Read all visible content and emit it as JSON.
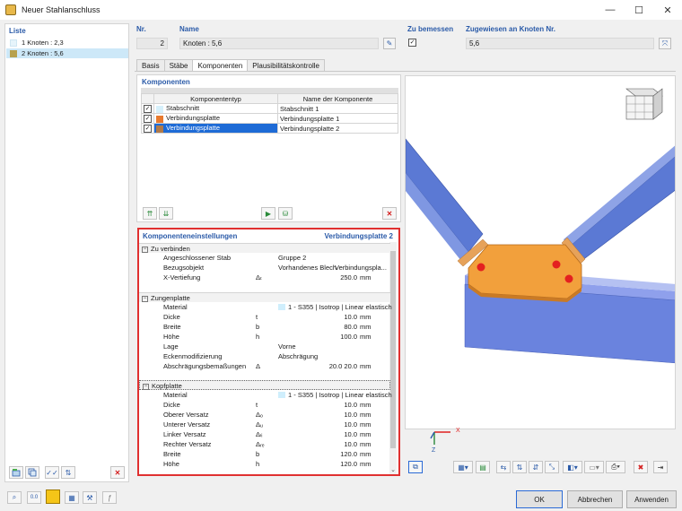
{
  "window": {
    "title": "Neuer Stahlanschluss"
  },
  "list": {
    "title": "Liste",
    "items": [
      {
        "label": "1  Knoten : 2,3",
        "color": "#e6f4fb"
      },
      {
        "label": "2  Knoten : 5,6",
        "color": "#b7a14d"
      }
    ]
  },
  "header": {
    "nr_label": "Nr.",
    "nr_value": "2",
    "name_label": "Name",
    "name_value": "Knoten : 5,6",
    "design_label": "Zu bemessen",
    "design_checked": "✓",
    "nodes_label": "Zugewiesen an Knoten Nr.",
    "nodes_value": "5,6"
  },
  "tabs": [
    "Basis",
    "Stäbe",
    "Komponenten",
    "Plausibilitätskontrolle"
  ],
  "components": {
    "title": "Komponenten",
    "col_type": "Komponententyp",
    "col_name": "Name der Komponente",
    "rows": [
      {
        "type": "Stabschnitt",
        "name": "Stabschnitt 1",
        "color": "#d6f0fb"
      },
      {
        "type": "Verbindungsplatte",
        "name": "Verbindungsplatte 1",
        "color": "#e87a2e"
      },
      {
        "type": "Verbindungsplatte",
        "name": "Verbindungsplatte 2",
        "color": "#e87a2e"
      }
    ]
  },
  "settings": {
    "title": "Komponenteneinstellungen",
    "subtitle": "Verbindungsplatte 2",
    "g1": "Zu verbinden",
    "g1_rows": [
      {
        "name": "Angeschlossener Stab",
        "sym": "",
        "val": "Gruppe 2",
        "val2": "",
        "unit": ""
      },
      {
        "name": "Bezugsobjekt",
        "sym": "",
        "val": "Vorhandenes Blech",
        "val2": "Verbindungspla...",
        "unit": ""
      },
      {
        "name": "X-Vertiefung",
        "sym": "Δₜ",
        "val": "250.0",
        "val2": "",
        "unit": "mm"
      }
    ],
    "g2": "Zungenplatte",
    "g2_rows": [
      {
        "name": "Material",
        "sym": "",
        "val": "1 - S355 | Isotrop | Linear elastisch",
        "unit": ""
      },
      {
        "name": "Dicke",
        "sym": "t",
        "val": "10.0",
        "unit": "mm"
      },
      {
        "name": "Breite",
        "sym": "b",
        "val": "80.0",
        "unit": "mm"
      },
      {
        "name": "Höhe",
        "sym": "h",
        "val": "100.0",
        "unit": "mm"
      },
      {
        "name": "Lage",
        "sym": "",
        "val": "Vorne",
        "unit": ""
      },
      {
        "name": "Eckenmodifizierung",
        "sym": "",
        "val": "Abschrägung",
        "unit": ""
      },
      {
        "name": "Abschrägungsbemaßungen",
        "sym": "Δ",
        "val": "20.0  20.0",
        "unit": "mm"
      }
    ],
    "g3": "Kopfplatte",
    "g3_rows": [
      {
        "name": "Material",
        "sym": "",
        "val": "1 - S355 | Isotrop | Linear elastisch",
        "unit": ""
      },
      {
        "name": "Dicke",
        "sym": "t",
        "val": "10.0",
        "unit": "mm"
      },
      {
        "name": "Oberer Versatz",
        "sym": "Δₒ",
        "val": "10.0",
        "unit": "mm"
      },
      {
        "name": "Unterer Versatz",
        "sym": "Δᵤ",
        "val": "10.0",
        "unit": "mm"
      },
      {
        "name": "Linker Versatz",
        "sym": "Δₗᵢ",
        "val": "10.0",
        "unit": "mm"
      },
      {
        "name": "Rechter Versatz",
        "sym": "Δᵣₑ",
        "val": "10.0",
        "unit": "mm"
      },
      {
        "name": "Breite",
        "sym": "b",
        "val": "120.0",
        "unit": "mm"
      },
      {
        "name": "Höhe",
        "sym": "h",
        "val": "120.0",
        "unit": "mm"
      }
    ]
  },
  "viewer": {
    "axis_x": "X",
    "axis_z": "Z"
  },
  "buttons": {
    "ok": "OK",
    "cancel": "Abbrechen",
    "apply": "Anwenden"
  }
}
